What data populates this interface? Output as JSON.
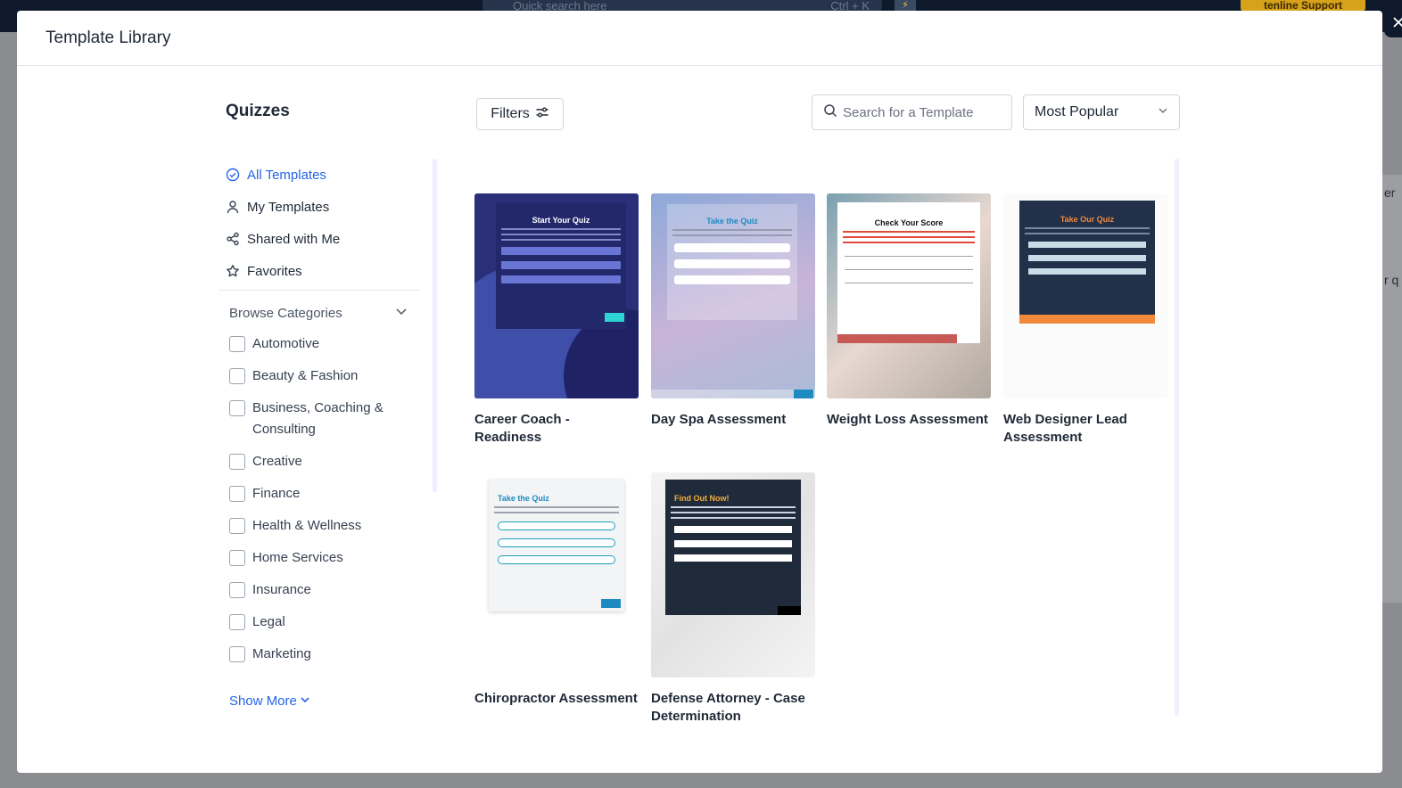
{
  "app": {
    "search_placeholder": "Quick search here",
    "search_shortcut": "Ctrl + K",
    "support_label": "tenline Support",
    "right_strip_chars": [
      "er",
      "r q"
    ]
  },
  "modal": {
    "title": "Template Library"
  },
  "sidebar": {
    "title": "Quizzes",
    "nav": [
      {
        "label": "All Templates",
        "icon": "check-circle-icon",
        "active": true
      },
      {
        "label": "My Templates",
        "icon": "user-icon",
        "active": false
      },
      {
        "label": "Shared with Me",
        "icon": "share-icon",
        "active": false
      },
      {
        "label": "Favorites",
        "icon": "star-icon",
        "active": false
      }
    ],
    "browse_label": "Browse Categories",
    "categories": [
      "Automotive",
      "Beauty & Fashion",
      "Business, Coaching & Consulting",
      "Creative",
      "Finance",
      "Health & Wellness",
      "Home Services",
      "Insurance",
      "Legal",
      "Marketing"
    ],
    "show_more": "Show More"
  },
  "toolbar": {
    "filters_label": "Filters",
    "search_placeholder": "Search for a Template",
    "sort_value": "Most Popular"
  },
  "templates": [
    {
      "title": "Career Coach - Readiness",
      "thumb_heading": "Start Your Quiz"
    },
    {
      "title": "Day Spa Assessment",
      "thumb_heading": "Take the Quiz"
    },
    {
      "title": "Weight Loss Assessment",
      "thumb_heading": "Check Your Score"
    },
    {
      "title": "Web Designer Lead Assessment",
      "thumb_heading": "Take Our Quiz"
    },
    {
      "title": "Chiropractor Assessment",
      "thumb_heading": "Take the Quiz"
    },
    {
      "title": "Defense Attorney - Case Determination",
      "thumb_heading": "Find Out Now!"
    }
  ],
  "colors": {
    "accent": "#2563eb",
    "app_header": "#0e1a2b"
  }
}
